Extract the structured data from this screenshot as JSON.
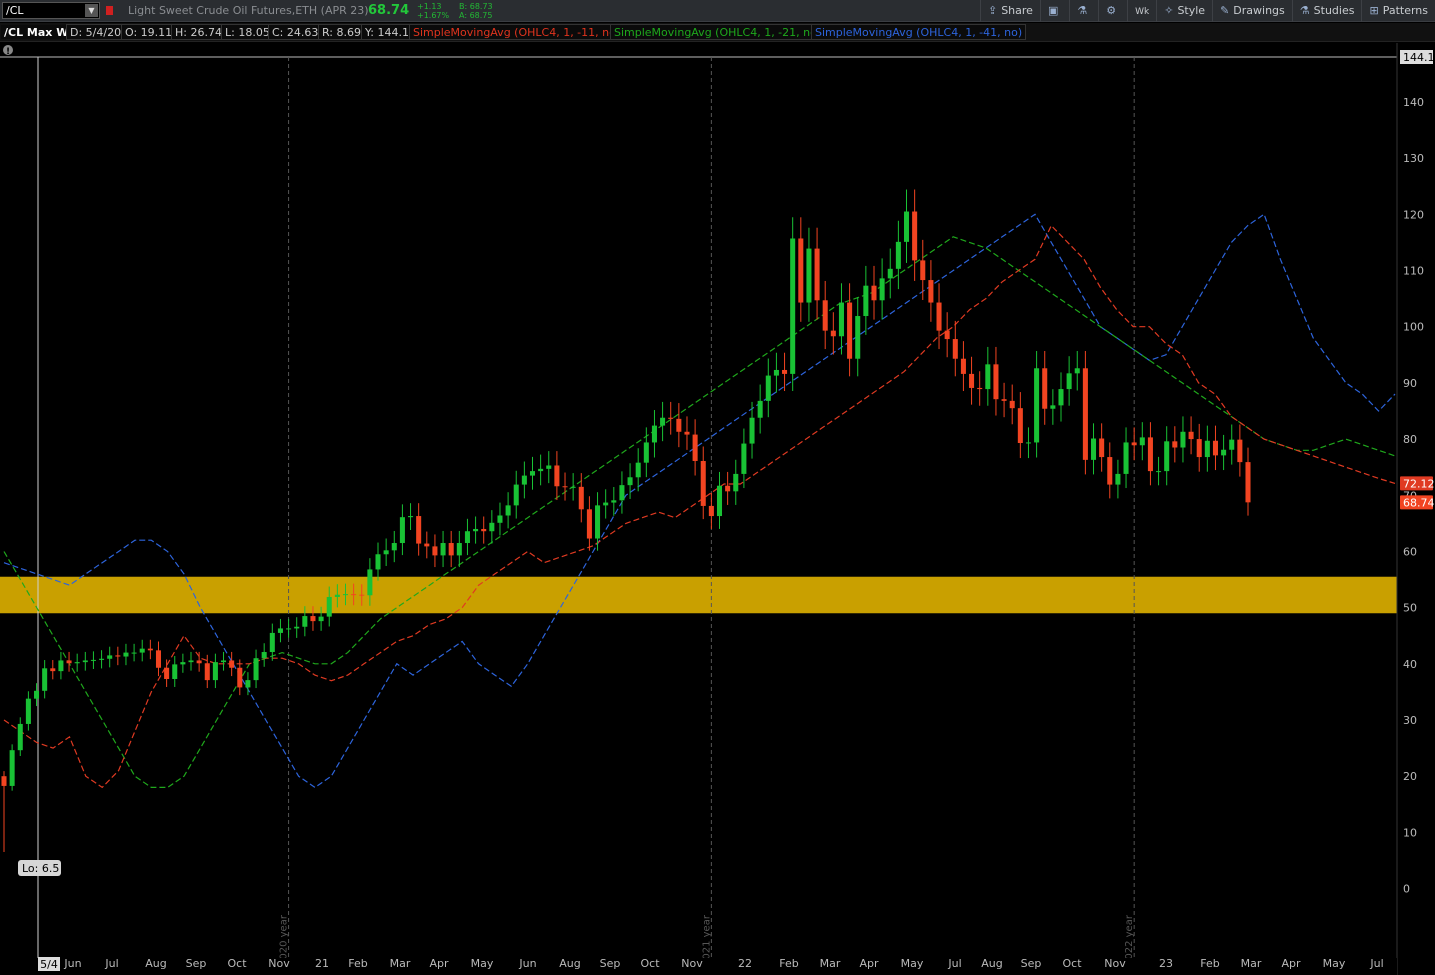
{
  "toolbar": {
    "symbol": "/CL",
    "description": "Light Sweet Crude Oil Futures,ETH (APR 23)",
    "last": "68.74",
    "change": "+1.13",
    "change_pct": "+1.67%",
    "bid": "B: 68.73",
    "ask": "A: 68.75",
    "share": "Share",
    "wk": "Wk",
    "style": "Style",
    "drawings": "Drawings",
    "studies": "Studies",
    "patterns": "Patterns"
  },
  "study_bar": {
    "title": "/CL Max W",
    "date": "D: 5/4/20",
    "open": "O: 19.11",
    "high": "H: 26.74",
    "low": "L: 18.05",
    "close": "C: 24.63",
    "range": "R: 8.69",
    "y": "Y: 144.1",
    "sma_red": "SimpleMovingAvg (OHLC4, 1, -11, no)",
    "sma_green": "SimpleMovingAvg (OHLC4, 1, -21, no)",
    "sma_blue": "SimpleMovingAvg (OHLC4, 1, -41, no)"
  },
  "chart_data": {
    "type": "candlestick",
    "title": "/CL Max W",
    "period": "weekly",
    "ylim": [
      -12,
      148
    ],
    "y_ticks": [
      0,
      10,
      20,
      30,
      40,
      50,
      60,
      70,
      80,
      90,
      100,
      110,
      120,
      130,
      140
    ],
    "x_labels": [
      "5/4",
      "Jun",
      "Jul",
      "Aug",
      "Sep",
      "Oct",
      "Nov",
      "21",
      "Feb",
      "Mar",
      "Apr",
      "May",
      "Jun",
      "Aug",
      "Sep",
      "Oct",
      "Nov",
      "22",
      "Feb",
      "Mar",
      "Apr",
      "May",
      "Jul",
      "Aug",
      "Sep",
      "Oct",
      "Nov",
      "23",
      "Feb",
      "Mar",
      "Apr",
      "May",
      "Jul"
    ],
    "year_separators": [
      "2020 year",
      "2021 year",
      "2022 year"
    ],
    "highlight_band": {
      "from": 49,
      "to": 55.5,
      "color": "#c9a000"
    },
    "price_labels": {
      "crosshair": "144.1",
      "sma_red": "72.12",
      "last": "68.74"
    },
    "low_marker": "Lo: 6.5",
    "colors": {
      "up": "#19c235",
      "down": "#f24421",
      "sma_red": "#e03a22",
      "sma_green": "#1fa81c",
      "sma_blue": "#2d64dc",
      "band": "#c9a000"
    },
    "start_week": "2020-04-27",
    "closes": [
      18.27,
      24.63,
      29.3,
      33.8,
      35.2,
      39.2,
      38.7,
      40.6,
      40.1,
      40.3,
      40.6,
      40.7,
      40.9,
      41.5,
      41.3,
      42.0,
      42.0,
      42.7,
      42.4,
      39.3,
      37.3,
      39.9,
      40.3,
      40.6,
      40.1,
      37.1,
      40.3,
      40.6,
      39.3,
      35.8,
      37.1,
      41.0,
      42.1,
      45.5,
      46.3,
      46.3,
      46.6,
      48.5,
      47.6,
      48.4,
      51.9,
      52.3,
      52.4,
      52.3,
      52.2,
      56.8,
      59.5,
      60.2,
      61.5,
      66.1,
      66.3,
      61.4,
      60.9,
      59.3,
      61.5,
      59.3,
      61.5,
      63.6,
      64.0,
      63.6,
      65.1,
      66.4,
      68.2,
      71.9,
      73.5,
      74.3,
      74.7,
      75.3,
      71.6,
      71.5,
      71.5,
      67.5,
      62.3,
      68.2,
      68.7,
      69.1,
      71.8,
      73.2,
      75.8,
      79.4,
      82.4,
      83.8,
      83.6,
      81.3,
      80.8,
      76.1,
      68.1,
      66.3,
      71.7,
      70.7,
      73.8,
      79.2,
      83.8,
      86.8,
      91.3,
      92.3,
      91.6,
      115.7,
      104.3,
      113.9,
      104.7,
      99.3,
      98.3,
      104.3,
      94.3,
      101.9,
      107.3,
      104.7,
      108.6,
      110.3,
      115.1,
      120.5,
      111.8,
      108.3,
      104.3,
      99.3,
      97.8,
      94.3,
      91.6,
      89.1,
      88.9,
      93.3,
      87.1,
      86.8,
      85.5,
      79.3,
      79.4,
      92.6,
      85.4,
      86.0,
      88.9,
      91.7,
      92.6,
      76.3,
      80.1,
      76.8,
      71.9,
      73.8,
      79.4,
      78.9,
      80.3,
      74.3,
      74.3,
      79.6,
      78.5,
      81.3,
      80.0,
      76.8,
      79.7,
      77.1,
      78.1,
      79.9,
      75.9,
      68.74
    ],
    "sma_red": [
      30,
      28,
      26,
      25,
      27,
      20,
      18,
      21,
      28,
      35,
      40,
      45,
      41,
      40,
      40,
      40,
      41,
      41,
      40,
      38,
      37,
      38,
      40,
      42,
      44,
      45,
      47,
      48,
      50,
      54,
      56,
      58,
      60,
      58,
      59,
      60,
      61,
      63,
      65,
      66,
      67,
      66,
      68,
      70,
      72,
      72,
      74,
      76,
      78,
      80,
      82,
      84,
      86,
      88,
      90,
      92,
      95,
      98,
      100,
      103,
      105,
      108,
      110,
      112,
      118,
      115,
      112,
      107,
      103,
      100,
      100,
      97,
      95,
      90,
      88,
      84,
      82,
      80,
      79,
      78,
      77,
      76,
      75,
      74,
      73,
      72.12
    ],
    "sma_green": [
      60,
      55,
      50,
      45,
      40,
      35,
      30,
      25,
      20,
      18,
      18,
      20,
      25,
      30,
      35,
      40,
      41,
      42,
      41,
      40,
      40,
      42,
      45,
      48,
      50,
      52,
      54,
      56,
      58,
      60,
      62,
      64,
      66,
      68,
      70,
      72,
      74,
      76,
      78,
      80,
      82,
      84,
      86,
      88,
      90,
      92,
      94,
      96,
      98,
      100,
      102,
      104,
      105,
      106,
      108,
      110,
      112,
      114,
      116,
      115,
      114,
      112,
      110,
      108,
      106,
      104,
      102,
      100,
      98,
      96,
      94,
      92,
      90,
      88,
      86,
      84,
      82,
      80,
      79,
      78,
      78,
      79,
      80,
      79,
      78,
      77
    ],
    "sma_blue": [
      58,
      57,
      56,
      55,
      54,
      56,
      58,
      60,
      62,
      62,
      60,
      56,
      50,
      45,
      40,
      35,
      30,
      25,
      20,
      18,
      20,
      25,
      30,
      35,
      40,
      38,
      40,
      42,
      44,
      40,
      38,
      36,
      40,
      45,
      50,
      55,
      60,
      65,
      70,
      72,
      74,
      76,
      78,
      80,
      82,
      84,
      86,
      88,
      90,
      92,
      94,
      96,
      98,
      100,
      102,
      104,
      106,
      108,
      110,
      112,
      114,
      116,
      118,
      120,
      115,
      110,
      105,
      100,
      98,
      96,
      94,
      95,
      100,
      105,
      110,
      115,
      118,
      120,
      112,
      105,
      98,
      94,
      90,
      88,
      85,
      88
    ]
  }
}
